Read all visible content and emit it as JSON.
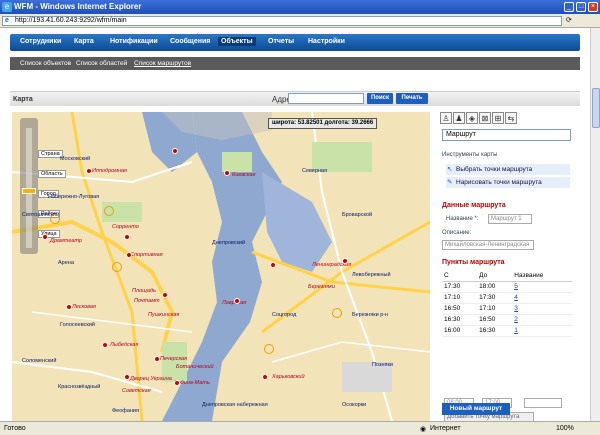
{
  "window": {
    "title": "WFM - Windows Internet Explorer",
    "url": "http://193.41.60.243:9292/wfm/main"
  },
  "nav": {
    "items": [
      "Сотрудники",
      "Карта",
      "Нотификации",
      "Сообщения",
      "Объекты",
      "Отчеты",
      "Настройки"
    ],
    "active": "Объекты"
  },
  "subnav": {
    "items": [
      "Список объектов",
      "Список областей",
      "Список маршрутов"
    ],
    "active": "Список маршрутов"
  },
  "panel": {
    "title": "Карта",
    "address_label": "Адрес",
    "search_btn": "Поиск",
    "print_btn": "Печать"
  },
  "map": {
    "coord": "широта: 53.82501  долгота: 39.2666",
    "zoom_labels": [
      "Улица",
      "Район",
      "Город",
      "Область",
      "Страна"
    ],
    "labels": [
      "Московский",
      "Набережно-Луговая",
      "Ипподромная",
      "Арена",
      "Сорренто",
      "Спортивная",
      "Драмтеатр",
      "Днепровский",
      "Площадь",
      "Почтамт",
      "Лесковая",
      "Лыбедская",
      "Голосеевский",
      "Дворец Украина",
      "Печерская",
      "Советская",
      "Соломенский",
      "Родина-Мать",
      "Березняки",
      "Северная",
      "Березняки р-н",
      "Харьковский",
      "Позняки",
      "Осокорки",
      "Ленинградская",
      "Киевская",
      "Святошинский",
      "Пушкинская",
      "Ботанический",
      "Лаврская",
      "Днепровская набережная",
      "Краснозвёздный",
      "Феофания",
      "Броварской",
      "Левобережный",
      "Соцгород"
    ]
  },
  "right": {
    "route_name": "Маршрут",
    "tools_title": "Инструменты карты",
    "tool1": "Выбрать точки маршрута",
    "tool2": "Нарисовать точки маршрута",
    "data_title": "Данные маршрута",
    "name_label": "Название *:",
    "name_value": "Маршрут 1",
    "desc_label": "Описание:",
    "desc_value": "Михайловская-Ленинградская",
    "points_title": "Пункты маршрута",
    "cols": [
      "С",
      "До",
      "Название"
    ],
    "rows": [
      [
        "17:30",
        "18:00",
        "5"
      ],
      [
        "17:10",
        "17:30",
        "4"
      ],
      [
        "16:50",
        "17:10",
        "3"
      ],
      [
        "16:30",
        "16:50",
        "2"
      ],
      [
        "16:00",
        "16:30",
        "1"
      ]
    ],
    "inputs": [
      "08:00",
      "17:00"
    ],
    "add_point": "Добавить точку маршрута",
    "new_route": "Новый маршрут"
  },
  "status": {
    "done": "Готово",
    "zone": "Интернет",
    "zoom": "100%"
  }
}
